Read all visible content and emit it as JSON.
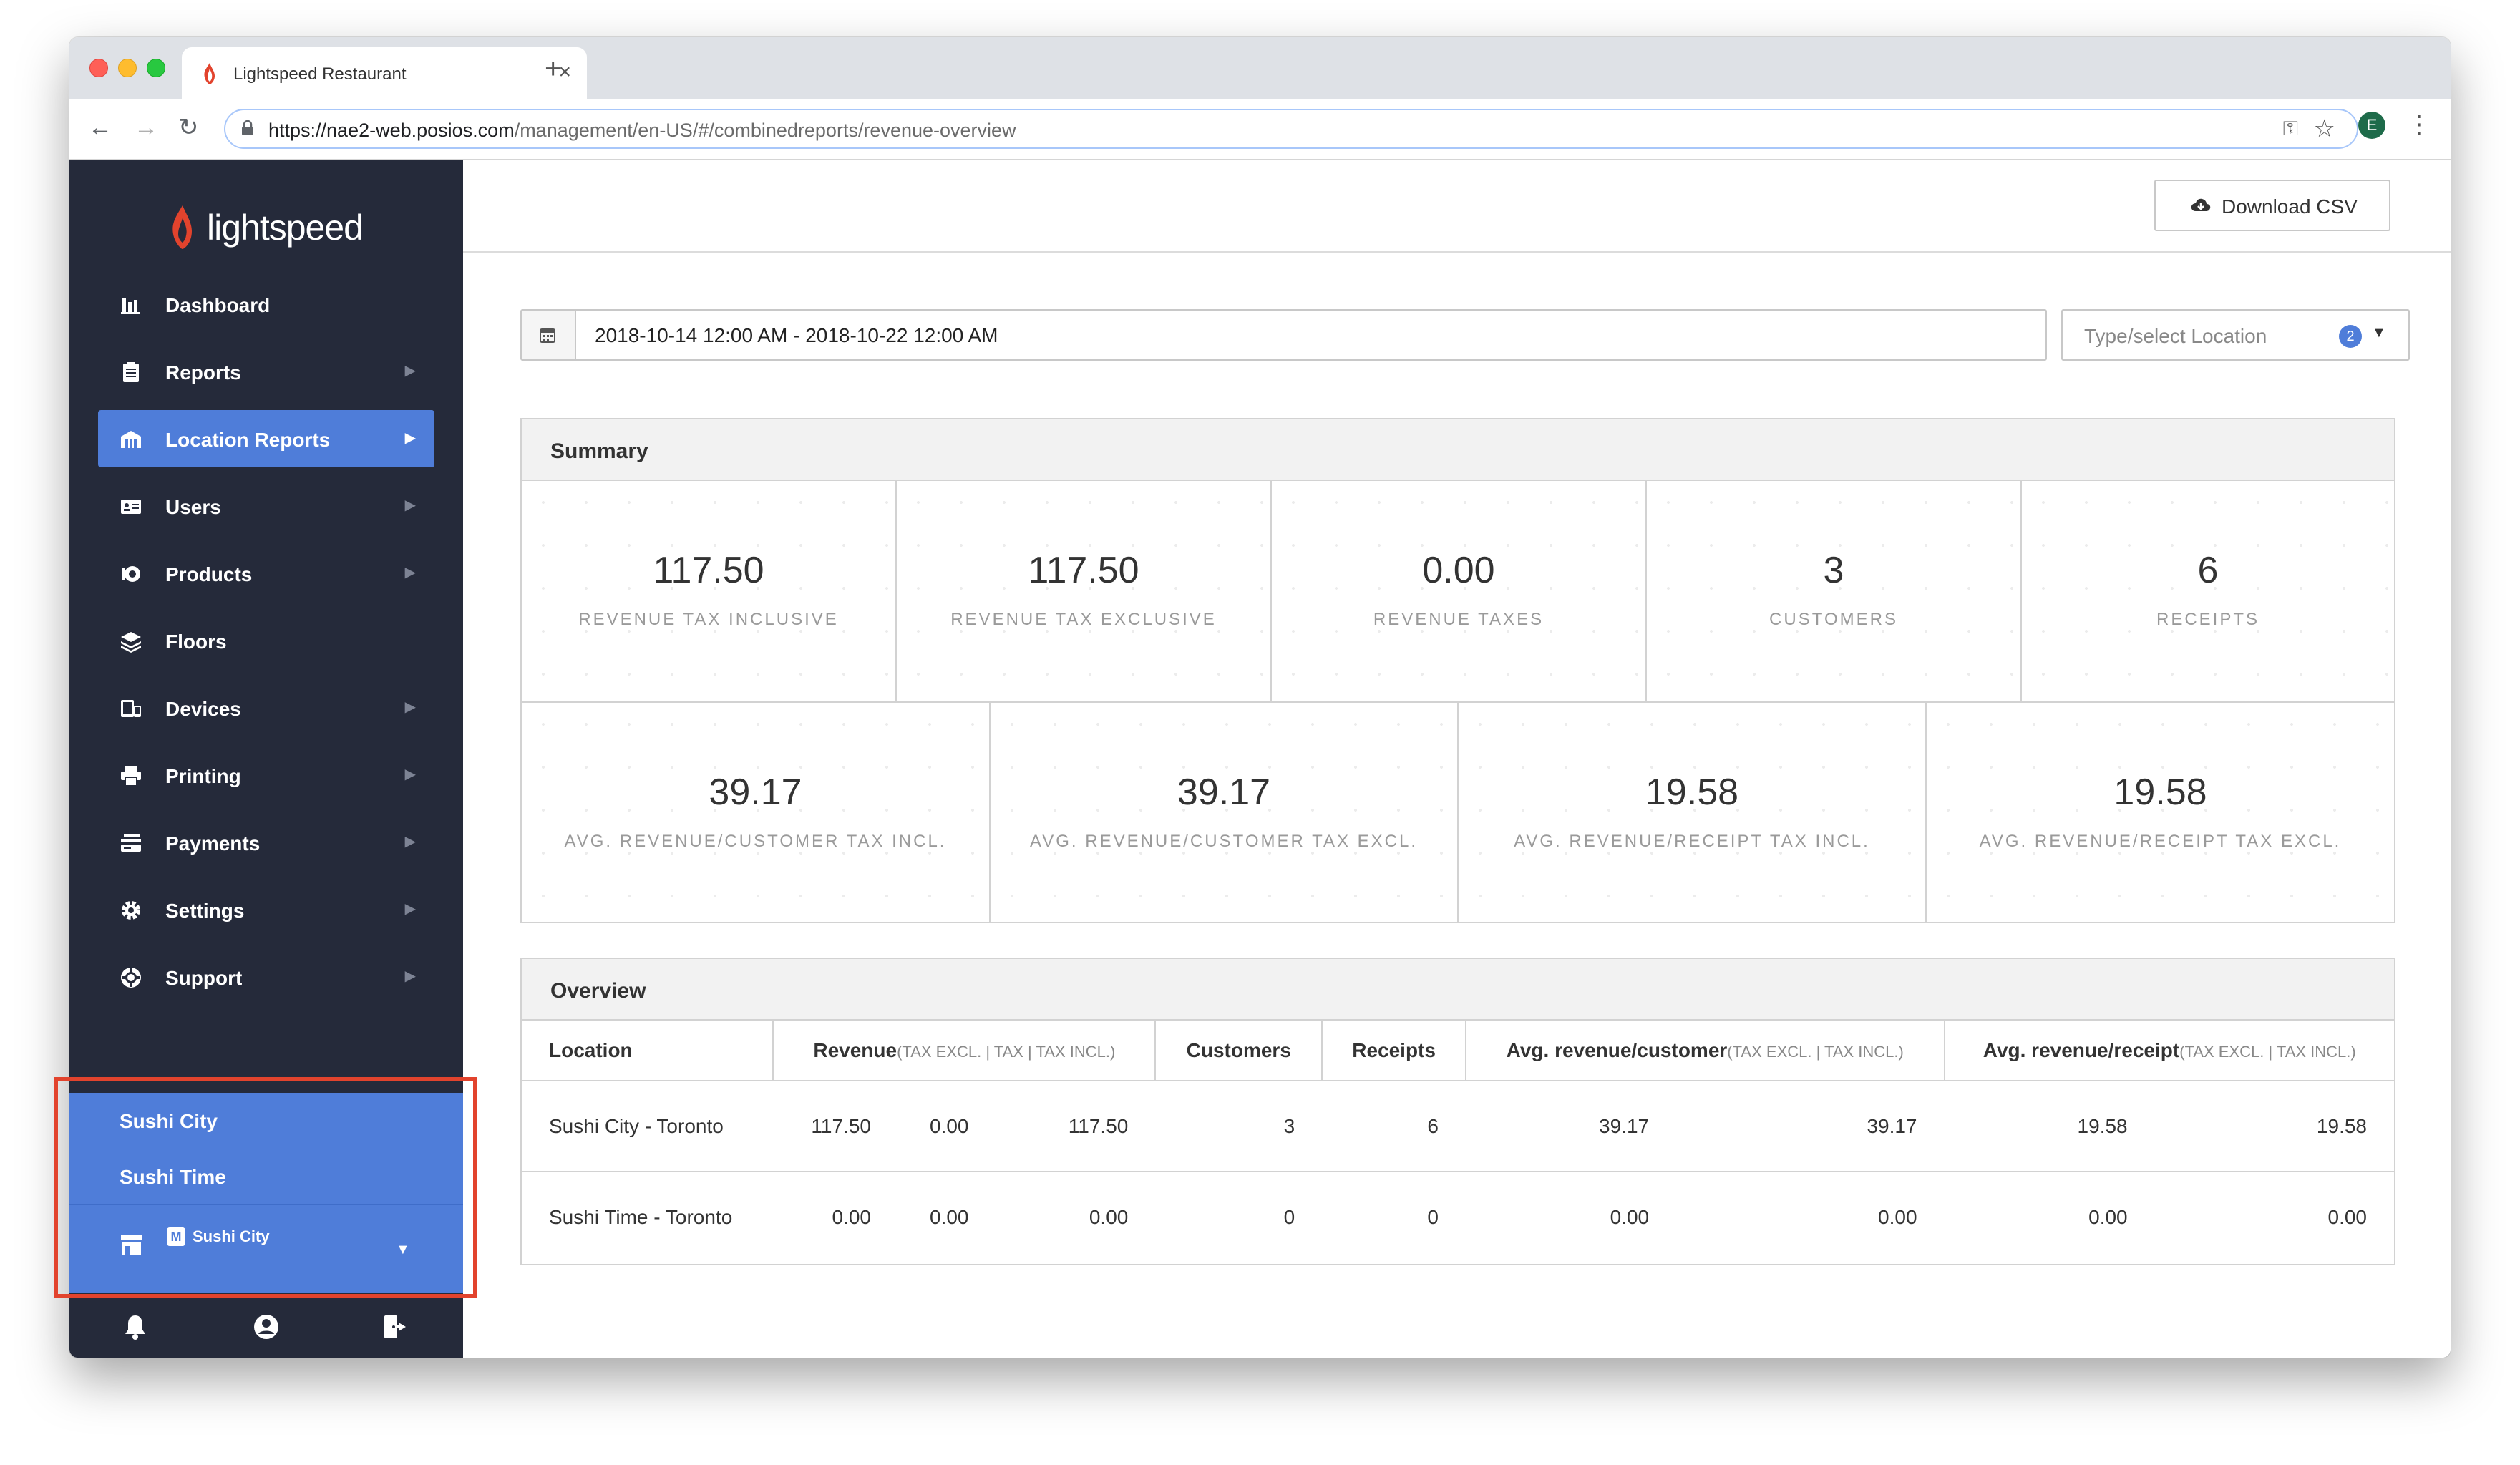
{
  "browser": {
    "tab_title": "Lightspeed Restaurant",
    "tab_close": "×",
    "new_tab": "+",
    "url_host": "https://nae2-web.posios.com",
    "url_path": "/management/en-US/#/combinedreports/revenue-overview",
    "profile_initial": "E"
  },
  "brand": {
    "logo_text": "lightspeed",
    "accent": "#e2432d"
  },
  "sidebar": {
    "items": [
      {
        "label": "Dashboard",
        "icon": "bar-chart-icon",
        "chevron": false
      },
      {
        "label": "Reports",
        "icon": "clipboard-icon",
        "chevron": true
      },
      {
        "label": "Location Reports",
        "icon": "building-icon",
        "chevron": true,
        "active": true
      },
      {
        "label": "Users",
        "icon": "id-card-icon",
        "chevron": true
      },
      {
        "label": "Products",
        "icon": "products-icon",
        "chevron": true
      },
      {
        "label": "Floors",
        "icon": "layers-icon",
        "chevron": false
      },
      {
        "label": "Devices",
        "icon": "devices-icon",
        "chevron": true
      },
      {
        "label": "Printing",
        "icon": "printer-icon",
        "chevron": true
      },
      {
        "label": "Payments",
        "icon": "payments-icon",
        "chevron": true
      },
      {
        "label": "Settings",
        "icon": "gear-icon",
        "chevron": true
      },
      {
        "label": "Support",
        "icon": "help-icon",
        "chevron": true
      }
    ],
    "locations": [
      "Sushi City",
      "Sushi Time"
    ],
    "current_location": {
      "badge": "M",
      "label": "Sushi City"
    }
  },
  "header": {
    "download_label": "Download CSV"
  },
  "filters": {
    "date_range": "2018-10-14 12:00 AM - 2018-10-22 12:00 AM",
    "location_placeholder": "Type/select Location",
    "location_count": "2"
  },
  "summary": {
    "title": "Summary",
    "row1": [
      {
        "value": "117.50",
        "label": "REVENUE TAX INCLUSIVE"
      },
      {
        "value": "117.50",
        "label": "REVENUE TAX EXCLUSIVE"
      },
      {
        "value": "0.00",
        "label": "REVENUE TAXES"
      },
      {
        "value": "3",
        "label": "CUSTOMERS"
      },
      {
        "value": "6",
        "label": "RECEIPTS"
      }
    ],
    "row2": [
      {
        "value": "39.17",
        "label": "AVG. REVENUE/CUSTOMER TAX INCL."
      },
      {
        "value": "39.17",
        "label": "AVG. REVENUE/CUSTOMER TAX EXCL."
      },
      {
        "value": "19.58",
        "label": "AVG. REVENUE/RECEIPT TAX INCL."
      },
      {
        "value": "19.58",
        "label": "AVG. REVENUE/RECEIPT TAX EXCL."
      }
    ]
  },
  "overview": {
    "title": "Overview",
    "headers": {
      "location": "Location",
      "revenue": "Revenue",
      "revenue_sub": "(TAX EXCL. | TAX | TAX INCL.)",
      "customers": "Customers",
      "receipts": "Receipts",
      "avg_customer": "Avg. revenue/customer",
      "avg_customer_sub": "(TAX EXCL. | TAX INCL.)",
      "avg_receipt": "Avg. revenue/receipt",
      "avg_receipt_sub": "(TAX EXCL. | TAX INCL.)"
    },
    "rows": [
      {
        "location": "Sushi City - Toronto",
        "cells": [
          "117.50",
          "0.00",
          "117.50",
          "3",
          "6",
          "39.17",
          "39.17",
          "19.58",
          "19.58"
        ]
      },
      {
        "location": "Sushi Time - Toronto",
        "cells": [
          "0.00",
          "0.00",
          "0.00",
          "0",
          "0",
          "0.00",
          "0.00",
          "0.00",
          "0.00"
        ]
      }
    ]
  }
}
